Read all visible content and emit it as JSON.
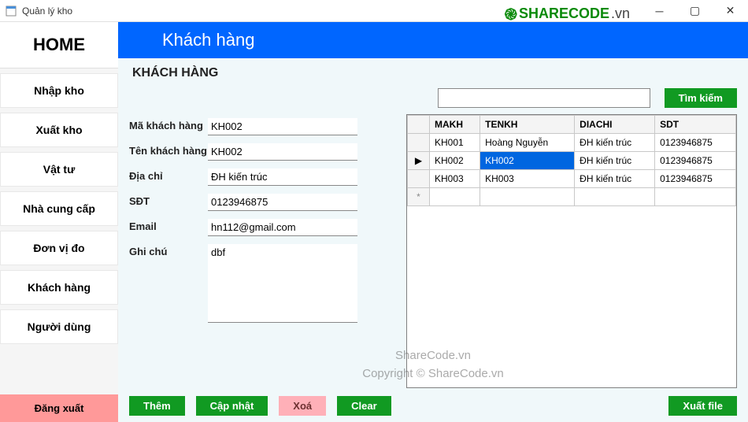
{
  "window": {
    "title": "Quản lý kho"
  },
  "brand": {
    "name": "SHARECODE",
    "tld": ".vn"
  },
  "sidebar": {
    "home": "HOME",
    "items": [
      {
        "label": "Nhập kho"
      },
      {
        "label": "Xuất kho"
      },
      {
        "label": "Vật tư"
      },
      {
        "label": "Nhà cung cấp"
      },
      {
        "label": "Đơn vị đo"
      },
      {
        "label": "Khách hàng"
      },
      {
        "label": "Người dùng"
      }
    ],
    "logout": "Đăng xuất"
  },
  "page": {
    "header": "Khách hàng",
    "section": "KHÁCH HÀNG"
  },
  "form": {
    "labels": {
      "ma": "Mã khách hàng",
      "ten": "Tên khách hàng",
      "diachi": "Địa chỉ",
      "sdt": "SĐT",
      "email": "Email",
      "ghichu": "Ghi chú"
    },
    "values": {
      "ma": "KH002",
      "ten": "KH002",
      "diachi": "ĐH kiến trúc",
      "sdt": "0123946875",
      "email": "hn112@gmail.com",
      "ghichu": "dbf"
    }
  },
  "search": {
    "value": "",
    "button": "Tìm kiếm"
  },
  "grid": {
    "columns": [
      "MAKH",
      "TENKH",
      "DIACHI",
      "SDT"
    ],
    "rows": [
      {
        "makh": "KH001",
        "tenkh": "Hoàng Nguyễn",
        "diachi": "ĐH kiến trúc",
        "sdt": "0123946875",
        "current": false
      },
      {
        "makh": "KH002",
        "tenkh": "KH002",
        "diachi": "ĐH kiến trúc",
        "sdt": "0123946875",
        "current": true,
        "sel_col": "tenkh"
      },
      {
        "makh": "KH003",
        "tenkh": "KH003",
        "diachi": "ĐH kiến trúc",
        "sdt": "0123946875",
        "current": false
      }
    ],
    "newrow_glyph": "*"
  },
  "actions": {
    "add": "Thêm",
    "update": "Cập nhật",
    "delete": "Xoá",
    "clear": "Clear",
    "export": "Xuất file"
  },
  "watermark": {
    "line1": "ShareCode.vn",
    "line2": "Copyright © ShareCode.vn"
  }
}
